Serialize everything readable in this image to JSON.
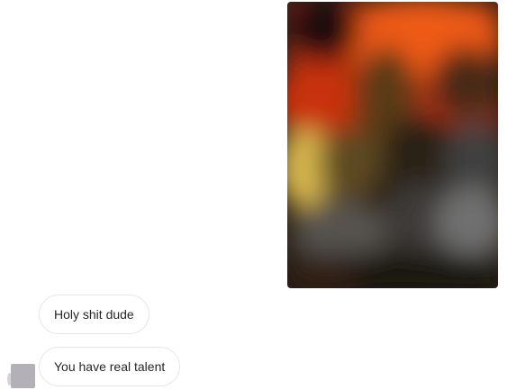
{
  "thread": {
    "media": {
      "kind": "blurred photo",
      "colors": [
        "#e8521a",
        "#c23a0a",
        "#3a2c12",
        "#d8c05a",
        "#6a6a6a",
        "#1c1a16"
      ]
    },
    "messages": [
      {
        "text": "Holy shit dude"
      },
      {
        "text": "You have real talent"
      }
    ],
    "avatar": {
      "icon": "user-avatar-placeholder"
    }
  }
}
